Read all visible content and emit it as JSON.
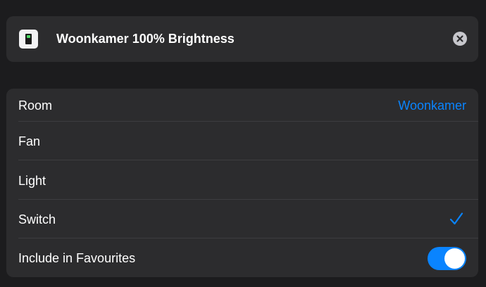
{
  "header": {
    "icon": "switch-accessory-icon",
    "title": "Woonkamer 100% Brightness",
    "clear_icon": "close-circle-icon"
  },
  "settings": {
    "room": {
      "label": "Room",
      "value": "Woonkamer"
    },
    "types": [
      {
        "label": "Fan",
        "selected": false
      },
      {
        "label": "Light",
        "selected": false
      },
      {
        "label": "Switch",
        "selected": true
      }
    ],
    "favourites": {
      "label": "Include in Favourites",
      "enabled": true
    }
  },
  "colors": {
    "background": "#1c1c1e",
    "card": "#2c2c2e",
    "accent": "#0a84ff",
    "text": "#ffffff"
  }
}
